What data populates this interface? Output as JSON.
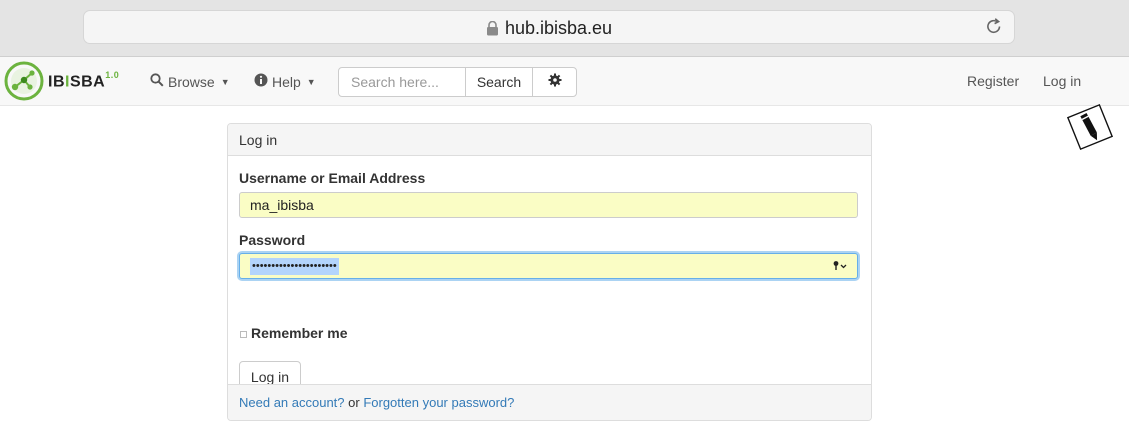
{
  "browser": {
    "url": "hub.ibisba.eu",
    "lock_icon": "lock-icon",
    "reload_icon": "reload-icon"
  },
  "navbar": {
    "brand": {
      "prefix": "IB",
      "separator": "I",
      "suffix": "SBA",
      "version": "1.0"
    },
    "browse_label": "Browse",
    "help_label": "Help",
    "search_placeholder": "Search here...",
    "search_button": "Search",
    "settings_icon": "gear-icon",
    "register_label": "Register",
    "login_label": "Log in"
  },
  "login_panel": {
    "heading": "Log in",
    "username_label": "Username or Email Address",
    "username_value": "ma_ibisba",
    "password_label": "Password",
    "password_masked": "••••••••••••••••••••••",
    "remember_label": "Remember me",
    "remember_checked": false,
    "submit_label": "Log in",
    "footer": {
      "need_account": "Need an account?",
      "or": " or ",
      "forgot": "Forgotten your password?"
    }
  },
  "colors": {
    "brand_green": "#6cb33f",
    "autofill_yellow": "#fafdc5",
    "link_blue": "#337ab7",
    "focus_blue": "#66afe9"
  }
}
